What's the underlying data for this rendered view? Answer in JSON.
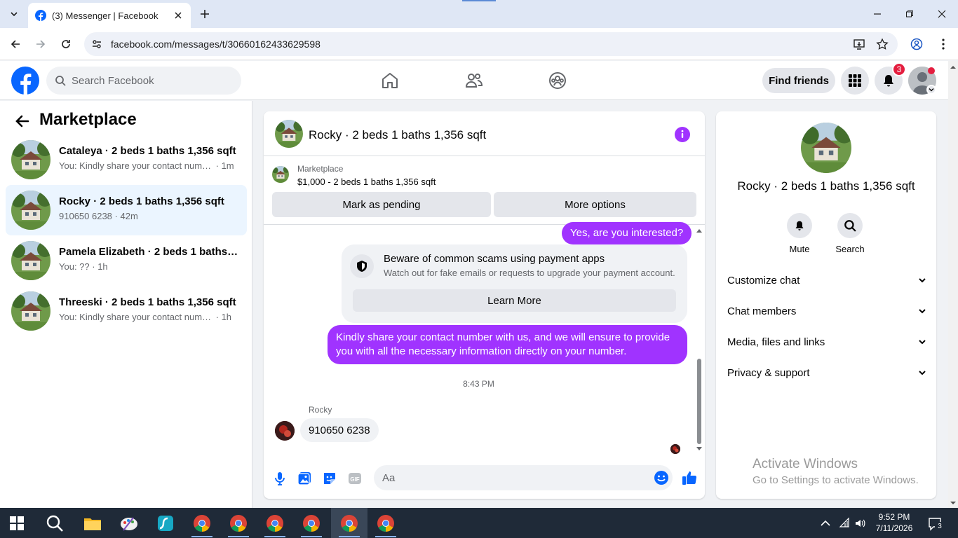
{
  "browser": {
    "tab_title": "(3) Messenger | Facebook",
    "url": "facebook.com/messages/t/30660162433629598"
  },
  "header": {
    "search_placeholder": "Search Facebook",
    "find_friends": "Find friends",
    "notifications_count": "3"
  },
  "sidebar": {
    "title": "Marketplace",
    "conversations": [
      {
        "name": "Cataleya · 2 beds 1 baths 1,356 sqft",
        "preview": "You: Kindly share your contact numb...",
        "time": "· 1m"
      },
      {
        "name": "Rocky · 2 beds 1 baths 1,356 sqft",
        "preview": "910650 6238",
        "time": "· 42m"
      },
      {
        "name": "Pamela Elizabeth · 2 beds 1 baths 1...",
        "preview": "You: ??",
        "time": "· 1h"
      },
      {
        "name": "Threeski · 2 beds 1 baths 1,356 sqft",
        "preview": "You: Kindly share your contact numbe...",
        "time": "· 1h"
      }
    ]
  },
  "chat": {
    "title": "Rocky · 2 beds 1 baths 1,356 sqft",
    "listing_label": "Marketplace",
    "listing_price": "$1,000 - 2 beds 1 baths 1,356 sqft",
    "mark_pending": "Mark as pending",
    "more_options": "More options",
    "msg_out_1": "Yes, are you interested?",
    "scam_title": "Beware of common scams using payment apps",
    "scam_body": "Watch out for fake emails or requests to upgrade your payment account.",
    "learn_more": "Learn More",
    "msg_out_2": "Kindly share your contact number with us, and we will ensure to provide you with all the necessary information directly on your number.",
    "timestamp": "8:43 PM",
    "sender": "Rocky",
    "msg_in_1": "910650 6238",
    "composer_placeholder": "Aa"
  },
  "details": {
    "name": "Rocky · 2 beds 1 baths 1,356 sqft",
    "mute": "Mute",
    "search": "Search",
    "sections": [
      "Customize chat",
      "Chat members",
      "Media, files and links",
      "Privacy & support"
    ]
  },
  "watermark": {
    "line1": "Activate Windows",
    "line2": "Go to Settings to activate Windows."
  },
  "taskbar": {
    "time": "9:52 PM",
    "date": "7/11/2026",
    "notif_count": "3"
  },
  "colors": {
    "fb_blue": "#0866ff",
    "messenger_purple": "#a033ff",
    "badge_red": "#e41e3f"
  }
}
